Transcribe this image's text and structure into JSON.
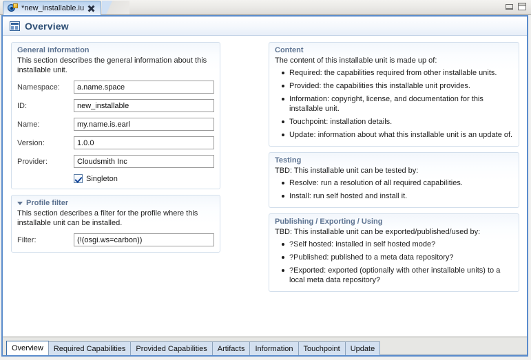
{
  "window": {
    "editor_tab_title": "*new_installable.iu",
    "tab_icon": "installable-unit-icon",
    "close_icon": "close-icon",
    "minimize_icon": "minimize-icon",
    "maximize_icon": "maximize-icon"
  },
  "form": {
    "header_icon": "overview-form-icon",
    "title": "Overview"
  },
  "general_information": {
    "title": "General information",
    "description": "This section describes the general information about this installable unit.",
    "fields": [
      {
        "label": "Namespace:",
        "value": "a.name.space"
      },
      {
        "label": "ID:",
        "value": "new_installable"
      },
      {
        "label": "Name:",
        "value": "my.name.is.earl"
      },
      {
        "label": "Version:",
        "value": "1.0.0"
      },
      {
        "label": "Provider:",
        "value": "Cloudsmith Inc"
      }
    ],
    "singleton": {
      "label": "Singleton",
      "checked": true
    }
  },
  "profile_filter": {
    "title": "Profile filter",
    "twistie": "chevron-down-icon",
    "description": "This section describes a filter for the profile where this installable unit can be installed.",
    "filter": {
      "label": "Filter:",
      "value": "(!(osgi.ws=carbon))"
    }
  },
  "content": {
    "title": "Content",
    "intro": "The content of this installable unit is made up of:",
    "items": [
      "Required: the capabilities required from other installable units.",
      "Provided: the capabilities this installable unit provides.",
      "Information: copyright, license, and documentation for this installable unit.",
      "Touchpoint: installation details.",
      "Update: information about what this installable unit is an update of."
    ]
  },
  "testing": {
    "title": "Testing",
    "intro": "TBD: This installable unit can be tested by:",
    "items": [
      "Resolve: run a resolution of all required capabilities.",
      "Install: run self hosted and install it."
    ]
  },
  "publishing": {
    "title": "Publishing / Exporting / Using",
    "intro": "TBD: This installable unit can be exported/published/used by:",
    "items": [
      "?Self hosted: installed in self hosted mode?",
      "?Published: published to a meta data repository?",
      "?Exported: exported (optionally with other installable units) to a local meta data repository?"
    ]
  },
  "page_tabs": {
    "active_index": 0,
    "items": [
      "Overview",
      "Required Capabilities",
      "Provided Capabilities",
      "Artifacts",
      "Information",
      "Touchpoint",
      "Update"
    ]
  },
  "colors": {
    "editor_border": "#5a8ccc",
    "section_title": "#5e7492",
    "form_title": "#2d4e74",
    "active_tab": "#ffffff",
    "tab_background": "#d3e0f0"
  }
}
